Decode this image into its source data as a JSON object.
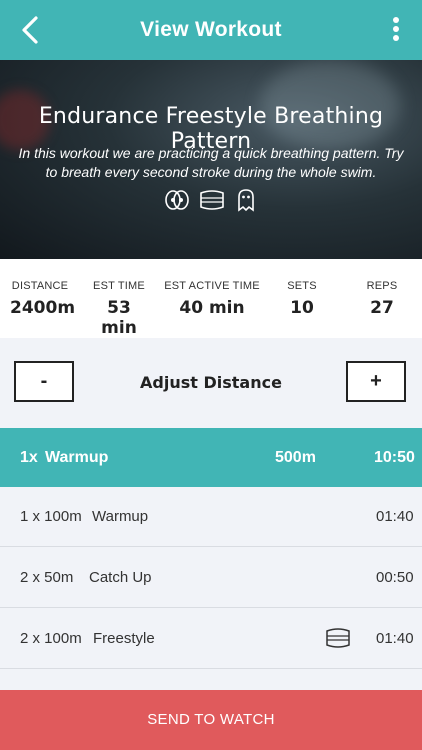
{
  "header": {
    "title": "View Workout",
    "back_icon": "chevron-left-icon",
    "menu_icon": "more-vertical-icon"
  },
  "hero": {
    "title": "Endurance Freestyle Breathing Pattern",
    "description": "In this workout we are practicing a quick breathing pattern. Try to breath every second stroke during the whole swim.",
    "equipment_icons": [
      "paddles-icon",
      "kickboard-icon",
      "pull-buoy-icon"
    ]
  },
  "stats": [
    {
      "label": "DISTANCE",
      "value": "2400m"
    },
    {
      "label": "EST TIME",
      "value": "53 min"
    },
    {
      "label": "EST ACTIVE TIME",
      "value": "40 min"
    },
    {
      "label": "SETS",
      "value": "10"
    },
    {
      "label": "REPS",
      "value": "27"
    }
  ],
  "adjust": {
    "minus": "-",
    "label": "Adjust Distance",
    "plus": "+"
  },
  "set": {
    "reps": "1x",
    "name": "Warmup",
    "distance": "500m",
    "time": "10:50"
  },
  "rows": [
    {
      "reps": "1 x 100m",
      "name": "Warmup",
      "time": "01:40"
    },
    {
      "reps": "2 x 50m",
      "name": "Catch Up",
      "time": "00:50"
    },
    {
      "reps": "2 x 100m",
      "name": "Freestyle",
      "time": "01:40",
      "icon": "kickboard-icon"
    }
  ],
  "send_button": "SEND TO WATCH",
  "colors": {
    "teal": "#41b5b5",
    "red": "#e05a5c",
    "background": "#f1f3f8"
  }
}
